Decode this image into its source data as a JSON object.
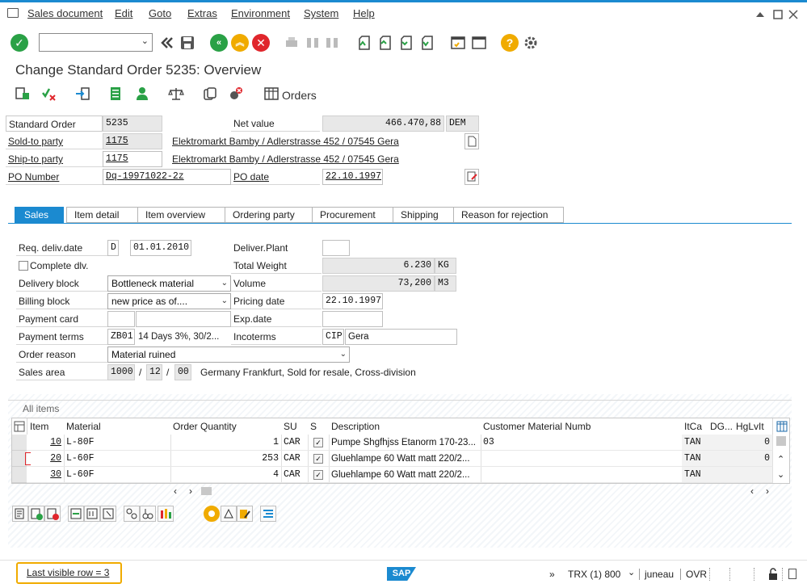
{
  "menubar": {
    "items": [
      "Sales document",
      "Edit",
      "Goto",
      "Extras",
      "Environment",
      "System",
      "Help"
    ]
  },
  "header": {
    "title": "Change Standard Order 5235: Overview",
    "orders_label": "Orders"
  },
  "order": {
    "standard_order_label": "Standard Order",
    "standard_order_value": "5235",
    "net_value_label": "Net value",
    "net_value": "466.470,88",
    "currency": "DEM",
    "sold_to_label": "Sold-to party",
    "sold_to_value": "1175",
    "sold_to_address": "Elektromarkt Bamby / Adlerstrasse 452 / 07545 Gera",
    "ship_to_label": "Ship-to party",
    "ship_to_value": "1175",
    "ship_to_address": "Elektromarkt Bamby / Adlerstrasse 452 / 07545 Gera",
    "po_number_label": "PO Number",
    "po_number_value": "Dq-19971022-2z",
    "po_date_label": "PO date",
    "po_date_value": "22.10.1997"
  },
  "tabs": [
    "Sales",
    "Item detail",
    "Item overview",
    "Ordering party",
    "Procurement",
    "Shipping",
    "Reason for rejection"
  ],
  "sales": {
    "req_deliv_label": "Req. deliv.date",
    "req_deliv_type": "D",
    "req_deliv_date": "01.01.2010",
    "deliver_plant_label": "Deliver.Plant",
    "complete_dlv_label": "Complete dlv.",
    "total_weight_label": "Total Weight",
    "total_weight": "6.230",
    "weight_unit": "KG",
    "delivery_block_label": "Delivery block",
    "delivery_block_value": "Bottleneck material",
    "volume_label": "Volume",
    "volume": "73,200",
    "volume_unit": "M3",
    "billing_block_label": "Billing block",
    "billing_block_value": "new price as of....",
    "pricing_date_label": "Pricing date",
    "pricing_date": "22.10.1997",
    "payment_card_label": "Payment card",
    "exp_date_label": "Exp.date",
    "payment_terms_label": "Payment terms",
    "payment_terms_code": "ZB01",
    "payment_terms_text": "14 Days 3%, 30/2...",
    "incoterms_label": "Incoterms",
    "incoterms_code": "CIP",
    "incoterms_place": "Gera",
    "order_reason_label": "Order reason",
    "order_reason_value": "Material ruined",
    "sales_area_label": "Sales area",
    "sales_org": "1000",
    "dist_channel": "12",
    "division": "00",
    "sales_area_text": "Germany Frankfurt, Sold for resale, Cross-division",
    "sep": "/"
  },
  "items": {
    "section_label": "All items",
    "columns": [
      "Item",
      "Material",
      "Order Quantity",
      "SU",
      "S",
      "Description",
      "Customer Material Numb",
      "ItCa",
      "DG...",
      "HgLvIt"
    ],
    "rows": [
      {
        "item": "10",
        "material": "L-80F",
        "qty": "1",
        "su": "CAR",
        "desc": "Pumpe Shgfhjss Etanorm 170-23...",
        "cust": "03",
        "itca": "TAN",
        "hglvit": "0"
      },
      {
        "item": "20",
        "material": "L-60F",
        "qty": "253",
        "su": "CAR",
        "desc": "Gluehlampe 60 Watt matt 220/2...",
        "cust": "",
        "itca": "TAN",
        "hglvit": "0"
      },
      {
        "item": "30",
        "material": "L-60F",
        "qty": "4",
        "su": "CAR",
        "desc": "Gluehlampe 60 Watt matt 220/2...",
        "cust": "",
        "itca": "TAN",
        "hglvit": ""
      }
    ]
  },
  "status": {
    "message": "Last visible row = 3",
    "system": "TRX (1) 800",
    "user": "juneau",
    "mode": "OVR",
    "brand": "SAP"
  },
  "colors": {
    "accent": "#1b8ad0",
    "confirm": "#2aa146",
    "nav_green": "#2aa146",
    "nav_orange": "#f0ab00",
    "cancel": "#e0262c",
    "help": "#f0ab00"
  }
}
